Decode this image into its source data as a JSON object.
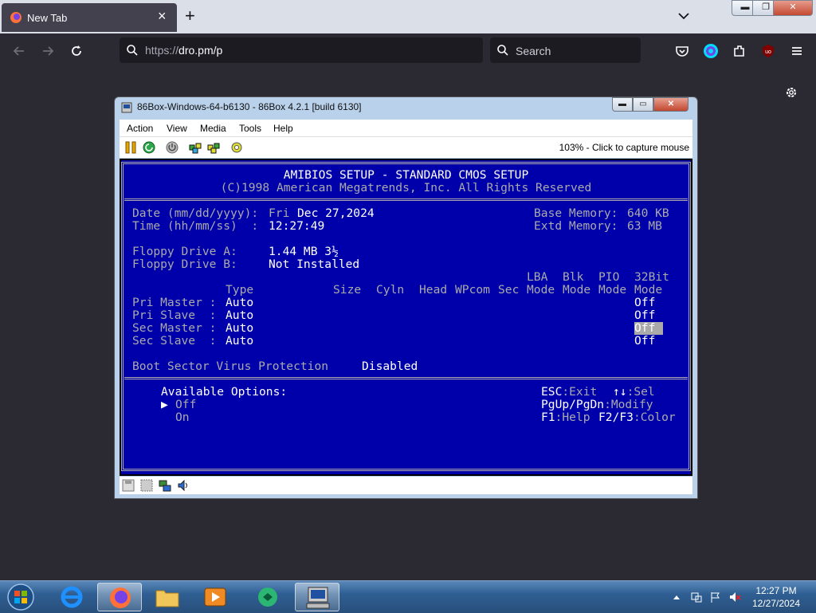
{
  "browser": {
    "tab_title": "New Tab",
    "url_scheme": "https://",
    "url_rest": "dro.pm/p",
    "search_placeholder": "Search"
  },
  "vm_window": {
    "title": "86Box-Windows-64-b6130 - 86Box 4.2.1 [build 6130]",
    "menu": [
      "Action",
      "View",
      "Media",
      "Tools",
      "Help"
    ],
    "capture_hint": "103% - Click to capture mouse"
  },
  "bios": {
    "title": "AMIBIOS SETUP - STANDARD CMOS SETUP",
    "copyright": "(C)1998 American Megatrends, Inc. All Rights Reserved",
    "date_label": "Date (mm/dd/yyyy):",
    "date_day": "Fri",
    "date_value": "Dec 27,2024",
    "time_label": "Time (hh/mm/ss)  :",
    "time_value": "12:27:49",
    "base_memory_label": "Base Memory:",
    "base_memory_value": "640 KB",
    "extd_memory_label": "Extd Memory:",
    "extd_memory_value": "63 MB",
    "floppy_a_label": "Floppy Drive A:",
    "floppy_a_value": "1.44 MB 3½",
    "floppy_b_label": "Floppy Drive B:",
    "floppy_b_value": "Not Installed",
    "headers_top": {
      "lba": "LBA",
      "blk": "Blk",
      "pio": "PIO",
      "bit32": "32Bit"
    },
    "headers": {
      "type": "Type",
      "size": "Size",
      "cyln": "Cyln",
      "head": "Head",
      "wpcom": "WPcom",
      "sec": "Sec",
      "lba": "Mode",
      "blk": "Mode",
      "pio": "Mode",
      "bit32": "Mode"
    },
    "drives": [
      {
        "label": "Pri Master :",
        "type": "Auto",
        "bit32": "Off"
      },
      {
        "label": "Pri Slave  :",
        "type": "Auto",
        "bit32": "Off"
      },
      {
        "label": "Sec Master :",
        "type": "Auto",
        "bit32": "Off"
      },
      {
        "label": "Sec Slave  :",
        "type": "Auto",
        "bit32": "Off"
      }
    ],
    "virus_label": "Boot Sector Virus Protection",
    "virus_value": "Disabled",
    "options_title": "Available Options:",
    "options": [
      "Off",
      "On"
    ],
    "selected_option_index": 0,
    "help": {
      "esc_key": "ESC",
      "esc_text": ":Exit",
      "sel_key": "↑↓",
      "sel_text": ":Sel",
      "pg_key": "PgUp/PgDn",
      "pg_text": ":Modify",
      "f1_key": "F1",
      "f1_text": ":Help",
      "f23_key": "F2/F3",
      "f23_text": ":Color"
    }
  },
  "taskbar": {
    "clock_time": "12:27 PM",
    "clock_date": "12/27/2024"
  },
  "colors": {
    "bios_bg": "#0000aa",
    "bios_text": "#aaaaaa",
    "bios_bright": "#ffffff",
    "browser_bg": "#2b2a33"
  }
}
